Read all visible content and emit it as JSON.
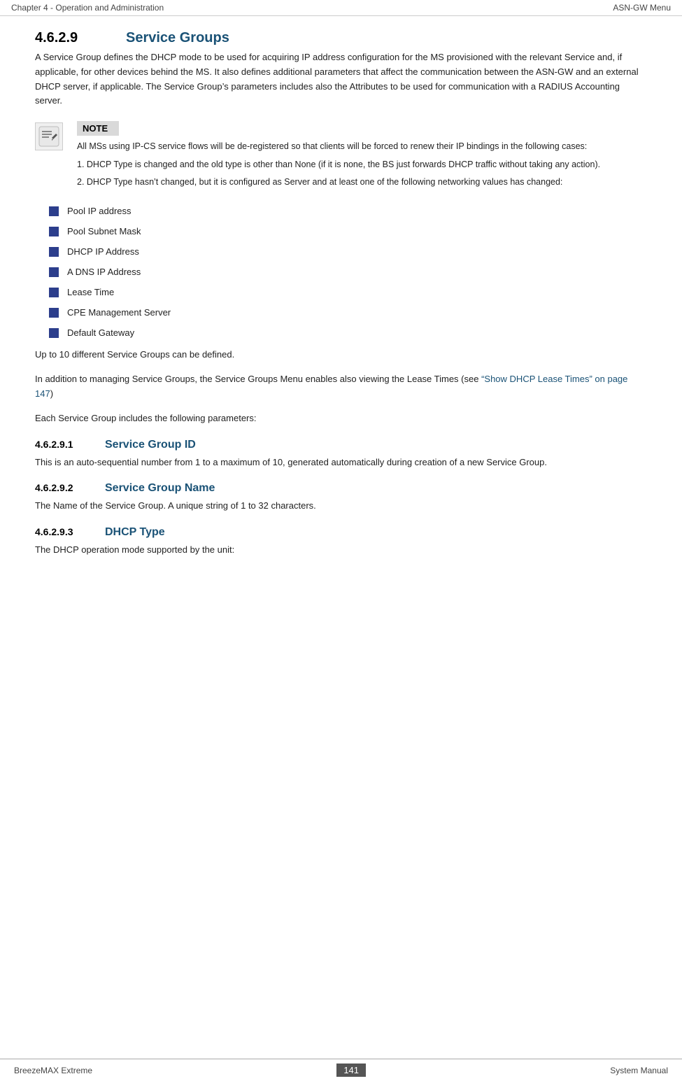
{
  "header": {
    "left": "Chapter 4 - Operation and Administration",
    "right": "ASN-GW Menu"
  },
  "section": {
    "number": "4.6.2.9",
    "title": "Service Groups",
    "intro": "A Service Group defines the DHCP mode to be used for acquiring IP address configuration for the MS provisioned with the relevant Service and, if applicable, for other devices behind the MS. It also defines additional parameters that affect the communication between the ASN-GW and an external DHCP server, if applicable. The Service Group’s parameters includes also the Attributes to be used for communication with a RADIUS Accounting server."
  },
  "note": {
    "label": "NOTE",
    "paragraph1": "All MSs using IP-CS service flows will be de-registered so that clients will be forced to renew their IP bindings in the following cases:",
    "item1": "1. DHCP Type is changed and the old type is other than None (if it is none, the BS just forwards DHCP traffic without taking any action).",
    "item2": "2. DHCP Type hasn’t changed, but it is configured as Server and at least one of the following networking values has changed:"
  },
  "bullets": [
    "Pool IP address",
    "Pool Subnet Mask",
    "DHCP IP Address",
    "A DNS IP Address",
    "Lease Time",
    "CPE Management Server",
    "Default Gateway"
  ],
  "paragraphs": [
    "Up to 10 different Service Groups can be defined.",
    "In addition to managing Service Groups, the Service Groups Menu enables also viewing the Lease Times (see “Show DHCP Lease Times” on page 147)",
    "Each Service Group includes the following parameters:"
  ],
  "subsections": [
    {
      "number": "4.6.2.9.1",
      "title": "Service Group ID",
      "body": "This is an auto-sequential number from 1 to a maximum of 10, generated automatically during creation of a new Service Group."
    },
    {
      "number": "4.6.2.9.2",
      "title": "Service Group Name",
      "body": "The Name of the Service Group. A unique string of 1 to 32 characters."
    },
    {
      "number": "4.6.2.9.3",
      "title": "DHCP Type",
      "body": "The DHCP operation mode supported by the unit:"
    }
  ],
  "link_text": "“Show DHCP Lease Times” on page 147",
  "footer": {
    "left": "BreezeMAX Extreme",
    "page": "141",
    "right": "System Manual"
  }
}
